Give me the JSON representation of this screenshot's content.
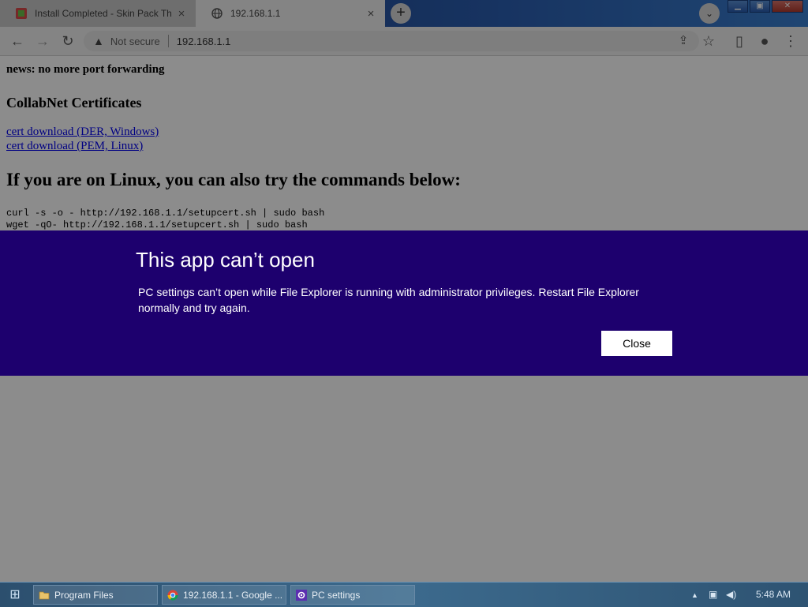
{
  "browser": {
    "tabs": [
      {
        "title": "Install Completed - Skin Pack Th",
        "favicon": "skinpack-icon",
        "close": "×"
      },
      {
        "title": "192.168.1.1",
        "favicon": "globe-icon",
        "close": "×"
      }
    ],
    "new_tab": "+",
    "tab_search": "⌄",
    "window_controls": {
      "minimize": "▁",
      "maximize": "▣",
      "close": "✕"
    },
    "toolbar": {
      "back": "←",
      "forward": "→",
      "reload": "↻",
      "security_icon": "▲",
      "security_label": "Not secure",
      "url": "192.168.1.1",
      "share": "⇪",
      "bookmark": "☆",
      "sidepanel": "▯",
      "profile": "●",
      "menu": "⋮"
    }
  },
  "page": {
    "news": "news: no more port forwarding",
    "certs_heading": "CollabNet Certificates",
    "links": [
      "cert download (DER, Windows)",
      "cert download (PEM, Linux)"
    ],
    "linux_heading": "If you are on Linux, you can also try the commands below:",
    "commands": [
      "curl -s -o - http://192.168.1.1/setupcert.sh | sudo bash",
      "wget -qO- http://192.168.1.1/setupcert.sh | sudo bash"
    ]
  },
  "dialog": {
    "title": "This app can’t open",
    "message": "PC settings can’t open while File Explorer is running with administrator privileges. Restart File Explorer normally and try again.",
    "close_label": "Close"
  },
  "taskbar": {
    "start": "⊞",
    "items": [
      {
        "label": "Program Files",
        "icon": "folder-icon"
      },
      {
        "label": "192.168.1.1 - Google ...",
        "icon": "chrome-icon"
      },
      {
        "label": "PC settings",
        "icon": "gear-icon"
      }
    ],
    "tray": {
      "arrow": "▲",
      "network": "▣",
      "volume": "◀)"
    },
    "clock": "5:48 AM"
  },
  "colors": {
    "dialog_bg": "#1d006e",
    "link": "#0000ee"
  }
}
